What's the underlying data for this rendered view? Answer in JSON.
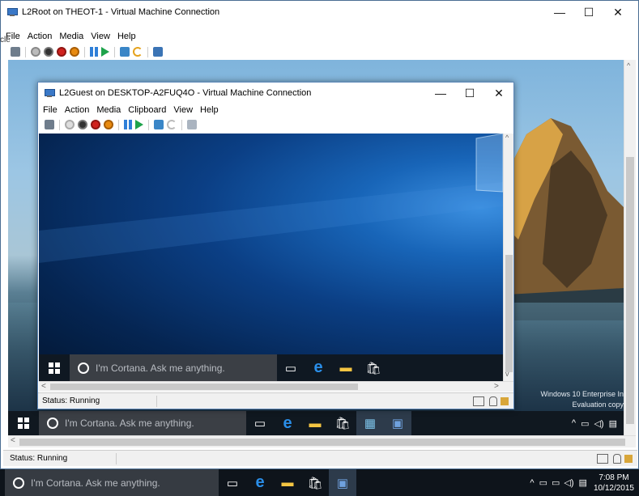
{
  "outer": {
    "title": "L2Root on THEOT-1 - Virtual Machine Connection",
    "menu": [
      "File",
      "Action",
      "Media",
      "View",
      "Help"
    ],
    "status": "Status: Running"
  },
  "inner": {
    "title": "L2Guest on DESKTOP-A2FUQ4O - Virtual Machine Connection",
    "menu": [
      "File",
      "Action",
      "Media",
      "Clipboard",
      "View",
      "Help"
    ],
    "status": "Status: Running"
  },
  "controls": {
    "minimize": "—",
    "maximize": "☐",
    "close": "✕"
  },
  "cortana": "I'm Cortana. Ask me anything.",
  "watermark": {
    "line1": "Windows 10 Enterprise In",
    "line2": "Evaluation copy"
  },
  "host_clock": {
    "time": "7:08 PM",
    "date": "10/12/2015"
  },
  "left_edge_text": "cle",
  "colors": {
    "accent": "#3a78c7",
    "taskbar": "#101820"
  },
  "icons": [
    "ctrl-alt-del-icon",
    "start-icon",
    "turn-off-icon",
    "shutdown-icon",
    "save-icon",
    "pause-icon",
    "resume-icon",
    "checkpoint-icon",
    "revert-icon",
    "enhanced-session-icon"
  ]
}
